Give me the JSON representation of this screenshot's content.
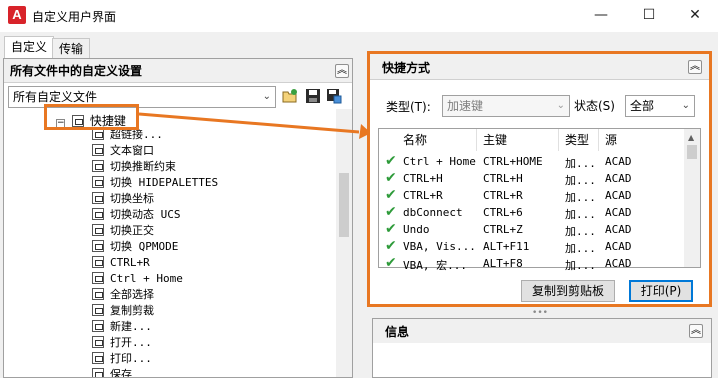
{
  "window": {
    "title": "自定义用户界面",
    "minimize": "—",
    "maximize": "☐",
    "close": "✕",
    "logo_letter": "A"
  },
  "tabs": [
    {
      "label": "自定义"
    },
    {
      "label": "传输"
    }
  ],
  "left": {
    "header": "所有文件中的自定义设置",
    "file_combo": "所有自定义文件",
    "tree_root": "快捷键",
    "tree_items": [
      {
        "label": "超链接..."
      },
      {
        "label": "文本窗口"
      },
      {
        "label": "切换推断约束"
      },
      {
        "label": "切换 HIDEPALETTES"
      },
      {
        "label": "切换坐标"
      },
      {
        "label": "切换动态 UCS"
      },
      {
        "label": "切换正交"
      },
      {
        "label": "切换 QPMODE"
      },
      {
        "label": "CTRL+R"
      },
      {
        "label": "Ctrl + Home"
      },
      {
        "label": "全部选择"
      },
      {
        "label": "复制剪裁"
      },
      {
        "label": "新建..."
      },
      {
        "label": "打开..."
      },
      {
        "label": "打印..."
      },
      {
        "label": "保存"
      }
    ]
  },
  "right": {
    "header": "快捷方式",
    "type_label": "类型(T):",
    "type_value": "加速键",
    "status_label": "状态(S)",
    "status_value": "全部",
    "columns": [
      "名称",
      "主键",
      "类型",
      "源"
    ],
    "rows": [
      {
        "name": "Ctrl + Home",
        "key": "CTRL+HOME",
        "type": "加...",
        "source": "ACAD"
      },
      {
        "name": "CTRL+H",
        "key": "CTRL+H",
        "type": "加...",
        "source": "ACAD"
      },
      {
        "name": "CTRL+R",
        "key": "CTRL+R",
        "type": "加...",
        "source": "ACAD"
      },
      {
        "name": "dbConnect",
        "key": "CTRL+6",
        "type": "加...",
        "source": "ACAD"
      },
      {
        "name": "Undo",
        "key": "CTRL+Z",
        "type": "加...",
        "source": "ACAD"
      },
      {
        "name": "VBA, Vis...",
        "key": "ALT+F11",
        "type": "加...",
        "source": "ACAD"
      },
      {
        "name": "VBA, 宏...",
        "key": "ALT+F8",
        "type": "加...",
        "source": "ACAD"
      }
    ],
    "copy_button": "复制到剪贴板",
    "print_button": "打印(P)"
  },
  "info": {
    "header": "信息"
  },
  "colors": {
    "accent": "#e87722",
    "check": "#2e9b3a",
    "logo": "#d8232a"
  }
}
